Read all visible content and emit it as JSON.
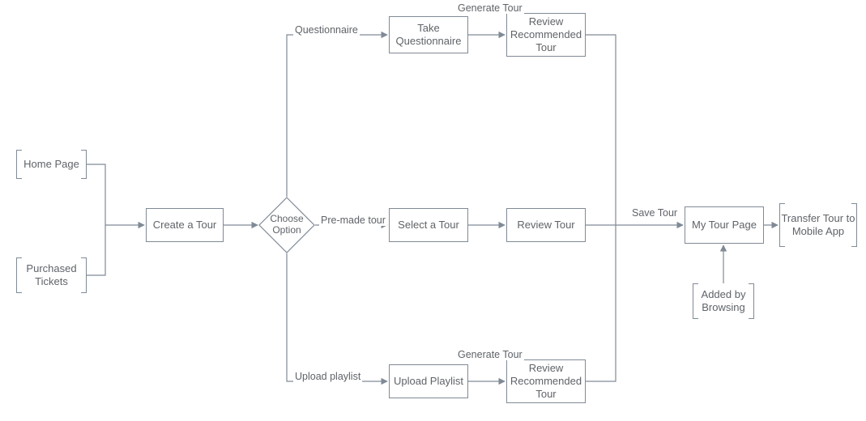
{
  "nodes": {
    "home_page": "Home Page",
    "purchased_tickets": "Purchased Tickets",
    "create_tour": "Create a Tour",
    "choose_option": "Choose Option",
    "take_questionnaire": "Take Questionnaire",
    "review_recommended_tour_top": "Review Recommended Tour",
    "select_tour": "Select a Tour",
    "review_tour": "Review Tour",
    "upload_playlist": "Upload Playlist",
    "review_recommended_tour_bottom": "Review Recommended Tour",
    "my_tour_page": "My Tour Page",
    "added_by_browsing": "Added by Browsing",
    "transfer_tour": "Transfer Tour to Mobile App"
  },
  "edge_labels": {
    "questionnaire": "Questionnaire",
    "premade_tour": "Pre-made tour",
    "upload_playlist": "Upload playlist",
    "generate_tour_top": "Generate Tour",
    "generate_tour_bottom": "Generate Tour",
    "save_tour": "Save Tour"
  }
}
